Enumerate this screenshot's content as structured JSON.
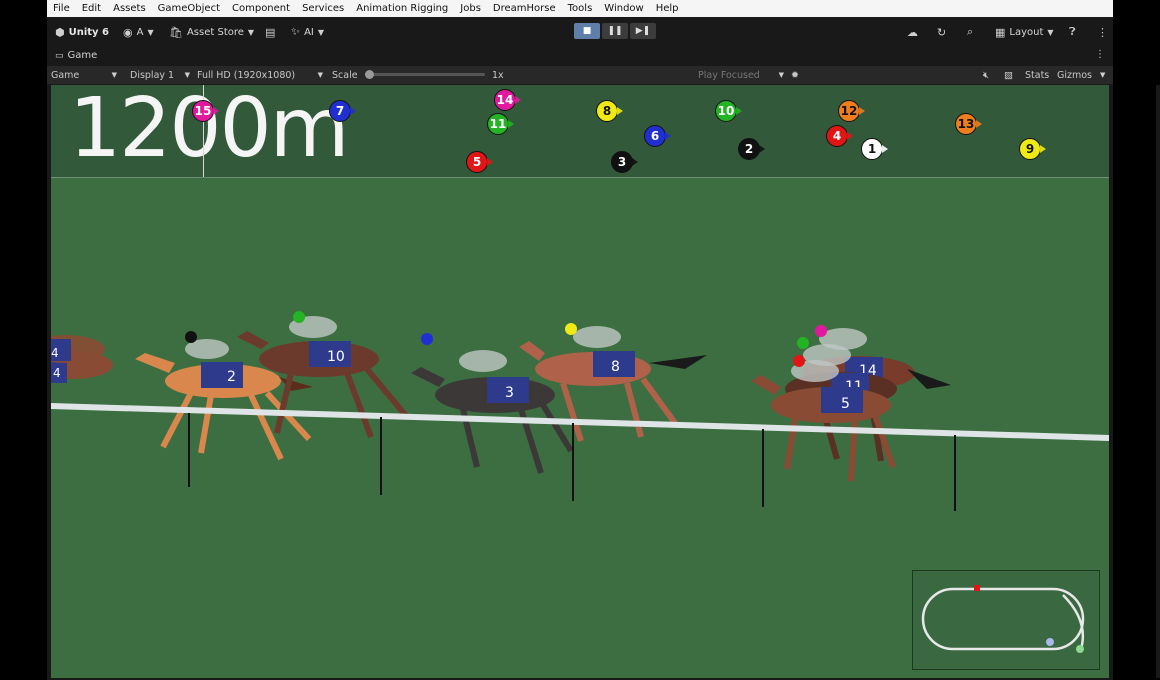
{
  "menu": [
    "File",
    "Edit",
    "Assets",
    "GameObject",
    "Component",
    "Services",
    "Animation Rigging",
    "Jobs",
    "DreamHorse",
    "Tools",
    "Window",
    "Help"
  ],
  "toolbar": {
    "product": "Unity 6",
    "account": "A",
    "asset_store": "Asset Store",
    "ai": "AI",
    "layout": "Layout"
  },
  "tab": {
    "label": "Game"
  },
  "gamebar": {
    "mode": "Game",
    "display": "Display 1",
    "resolution": "Full HD (1920x1080)",
    "scale_label": "Scale",
    "scale_value": "1x",
    "play_focused": "Play Focused",
    "stats": "Stats",
    "gizmos": "Gizmos"
  },
  "race": {
    "distance": "1200m",
    "markers": [
      {
        "n": "15",
        "color": "#e0199f",
        "text": "#ffffff"
      },
      {
        "n": "7",
        "color": "#1f2fd1",
        "text": "#ffffff"
      },
      {
        "n": "14",
        "color": "#e0199f",
        "text": "#ffffff"
      },
      {
        "n": "11",
        "color": "#22b422",
        "text": "#ffffff"
      },
      {
        "n": "5",
        "color": "#e01616",
        "text": "#ffffff"
      },
      {
        "n": "8",
        "color": "#f0ea14",
        "text": "#111111"
      },
      {
        "n": "3",
        "color": "#111111",
        "text": "#ffffff"
      },
      {
        "n": "6",
        "color": "#1f2fd1",
        "text": "#ffffff"
      },
      {
        "n": "10",
        "color": "#22b422",
        "text": "#ffffff"
      },
      {
        "n": "2",
        "color": "#111111",
        "text": "#ffffff"
      },
      {
        "n": "12",
        "color": "#ee7d1e",
        "text": "#111111"
      },
      {
        "n": "4",
        "color": "#e01616",
        "text": "#ffffff"
      },
      {
        "n": "1",
        "color": "#ffffff",
        "text": "#111111"
      },
      {
        "n": "13",
        "color": "#ee7d1e",
        "text": "#111111"
      },
      {
        "n": "9",
        "color": "#f0ea14",
        "text": "#111111"
      }
    ],
    "saddle_numbers": [
      "2",
      "10",
      "3",
      "8",
      "14",
      "11",
      "5",
      "4"
    ]
  },
  "colors": {
    "grass": "#3c6e41",
    "band": "#32593a",
    "rail": "#dfe5e6"
  }
}
